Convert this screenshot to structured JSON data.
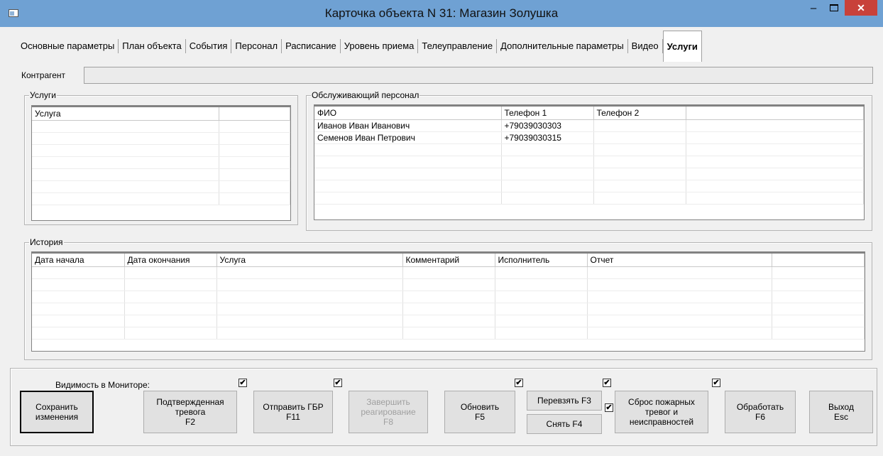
{
  "window": {
    "title": "Карточка объекта N 31: Магазин Золушка",
    "min_glyph": "–",
    "close_glyph": "✕"
  },
  "tabs": [
    {
      "label": "Основные параметры"
    },
    {
      "label": "План объекта"
    },
    {
      "label": "События"
    },
    {
      "label": "Персонал"
    },
    {
      "label": "Расписание"
    },
    {
      "label": "Уровень приема"
    },
    {
      "label": "Телеуправление"
    },
    {
      "label": "Дополнительные параметры"
    },
    {
      "label": "Видео"
    },
    {
      "label": "Услуги"
    }
  ],
  "active_tab": "Услуги",
  "contractor": {
    "label": "Контрагент",
    "value": ""
  },
  "services": {
    "title": "Услуги",
    "columns": [
      "Услуга",
      ""
    ]
  },
  "staff": {
    "title": "Обслуживающий персонал",
    "columns": [
      "ФИО",
      "Телефон 1",
      "Телефон 2",
      ""
    ],
    "rows": [
      [
        "Иванов Иван Иванович",
        "+79039030303",
        "",
        ""
      ],
      [
        "Семенов Иван Петрович",
        "+79039030315",
        "",
        ""
      ]
    ]
  },
  "history": {
    "title": "История",
    "columns": [
      "Дата начала",
      "Дата окончания",
      "Услуга",
      "Комментарий",
      "Исполнитель",
      "Отчет",
      ""
    ]
  },
  "bottom": {
    "visibility_label": "Видимость в Мониторе:",
    "check_glyph": "✔",
    "buttons": {
      "save": {
        "line1": "Сохранить",
        "line2": "изменения"
      },
      "confirmed": {
        "line1": "Подтвержденная",
        "line2": "тревога",
        "line3": "F2"
      },
      "send_gbr": {
        "line1": "Отправить ГБР",
        "line2": "F11"
      },
      "finish": {
        "line1": "Завершить",
        "line2": "реагирование",
        "line3": "F8"
      },
      "refresh": {
        "line1": "Обновить",
        "line2": "F5"
      },
      "reassign": {
        "label": "Перевзять F3"
      },
      "remove": {
        "label": "Снять F4"
      },
      "fire_reset": {
        "line1": "Сброс пожарных",
        "line2": "тревог и",
        "line3": "неисправностей"
      },
      "process": {
        "line1": "Обработать",
        "line2": "F6"
      },
      "exit": {
        "line1": "Выход",
        "line2": "Esc"
      }
    },
    "checkboxes": {
      "confirmed": true,
      "send_gbr": true,
      "refresh": true,
      "reassign": true,
      "remove": true,
      "fire_reset": true
    }
  }
}
